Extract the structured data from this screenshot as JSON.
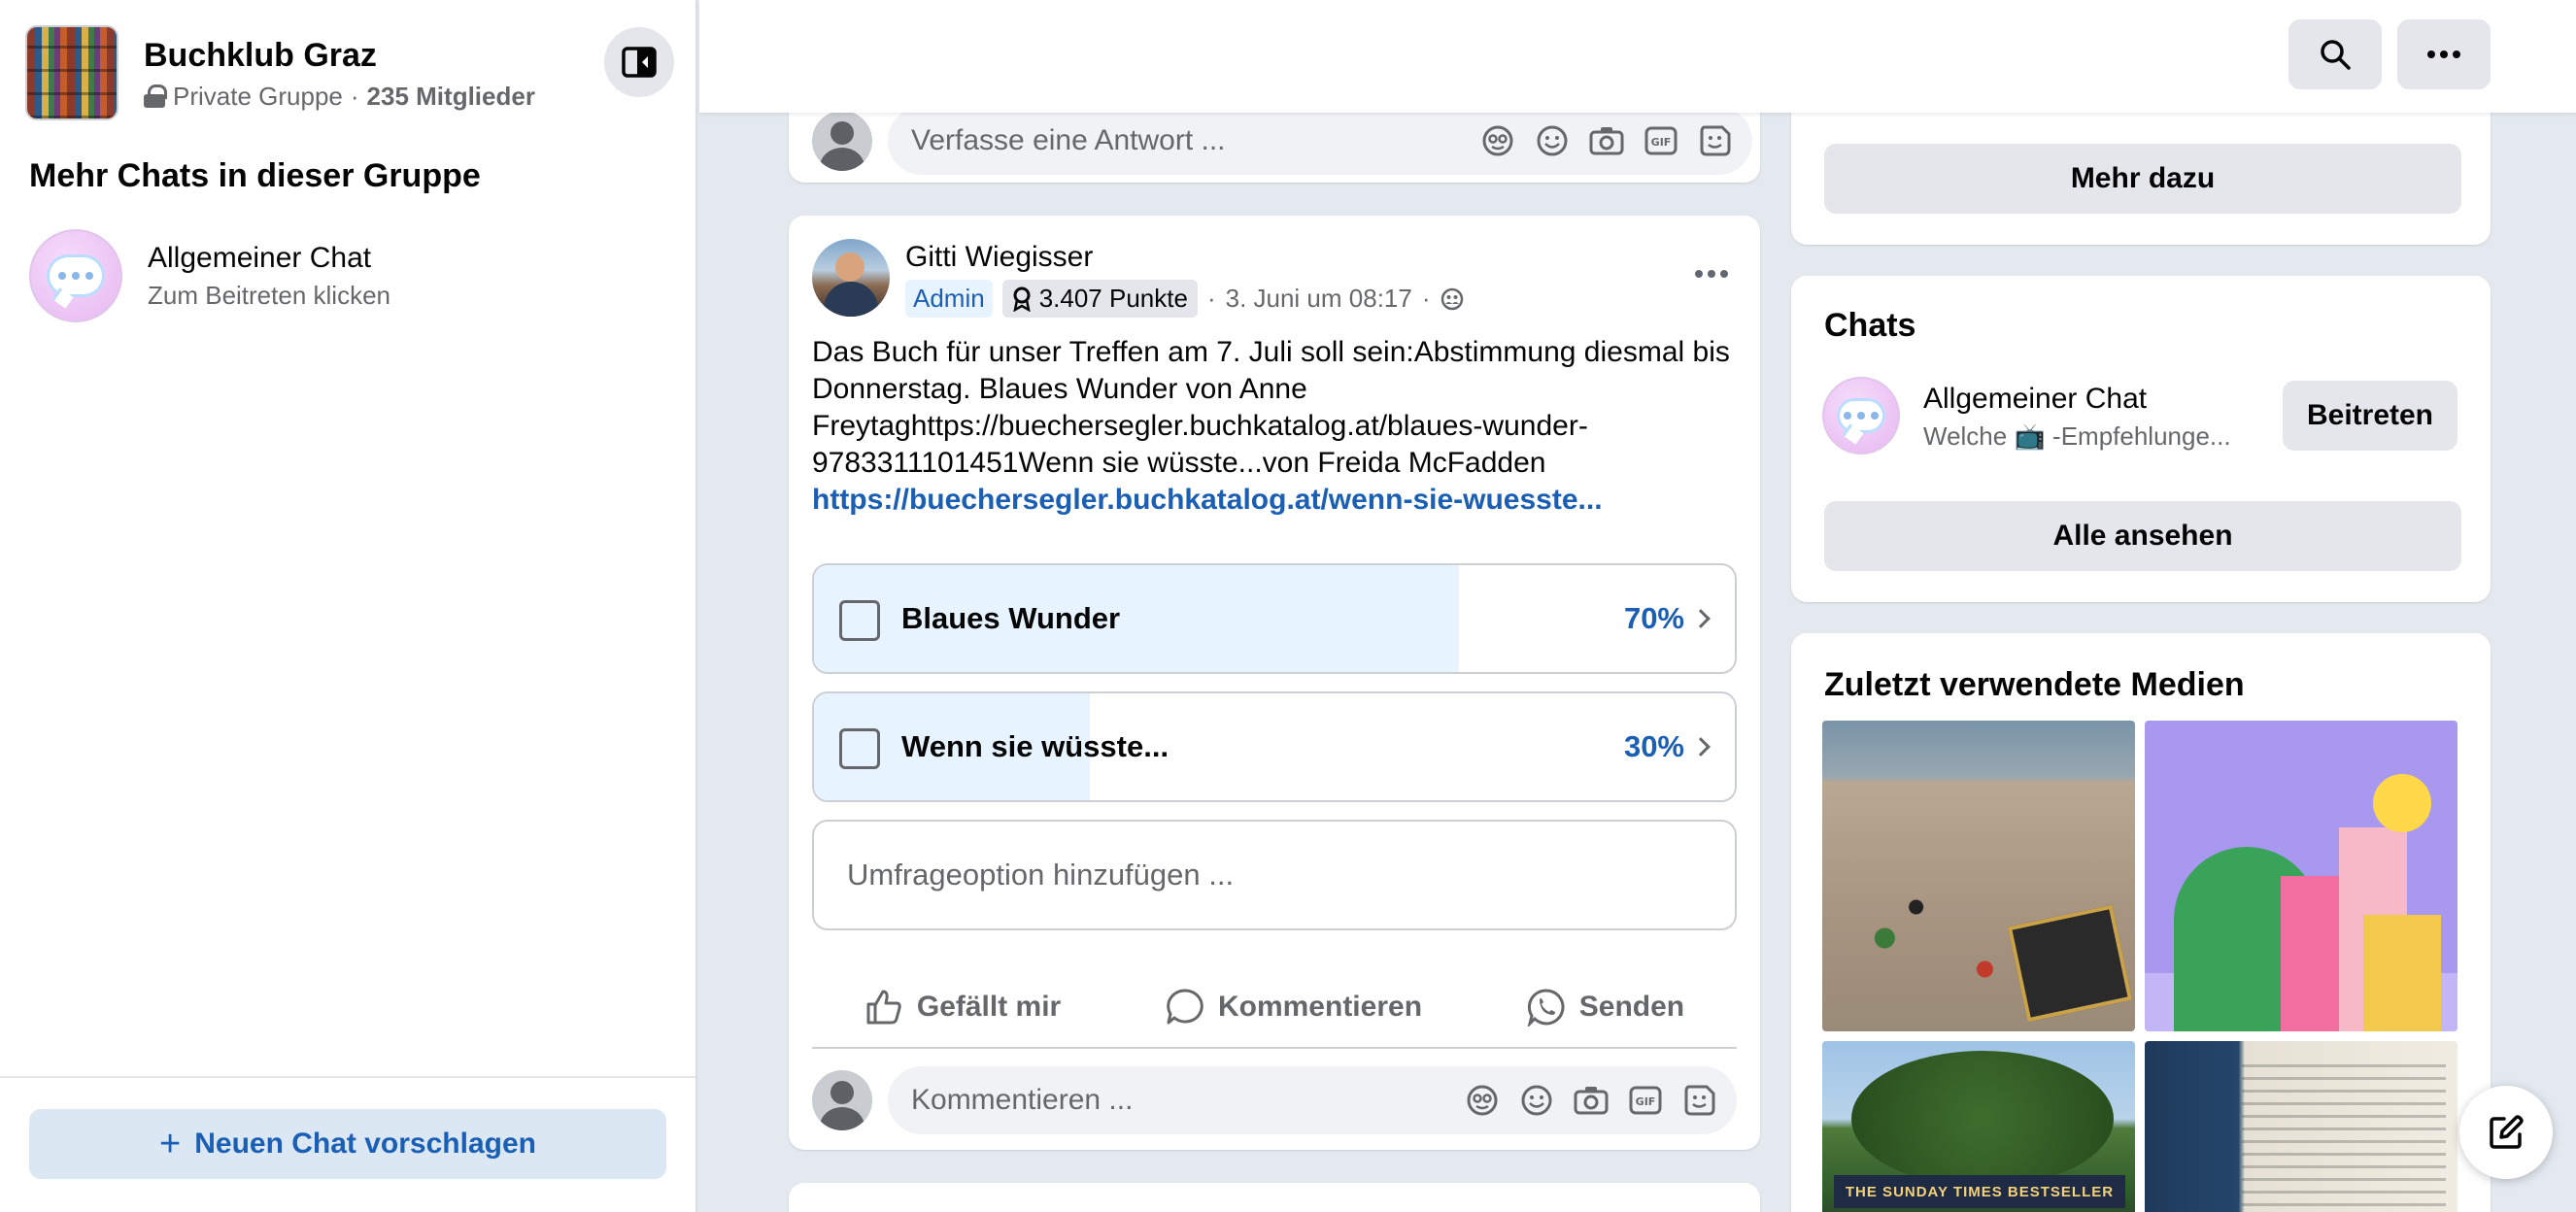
{
  "group": {
    "title": "Buchklub Graz",
    "privacy": "Private Gruppe",
    "separator": "·",
    "members": "235 Mitglieder"
  },
  "sidebar": {
    "section_title": "Mehr Chats in dieser Gruppe",
    "chats": [
      {
        "name": "Allgemeiner Chat",
        "subtitle": "Zum Beitreten klicken"
      }
    ],
    "suggest_button": "Neuen Chat vorschlagen"
  },
  "feed": {
    "reply_placeholder": "Verfasse eine Antwort ...",
    "post": {
      "author": "Gitti Wiegisser",
      "role": "Admin",
      "points": "3.407 Punkte",
      "timestamp": "3. Juni um 08:17",
      "separator": "·",
      "text": "Das Buch für unser Treffen am 7. Juli soll sein:Abstimmung diesmal bis Donnerstag. Blaues Wunder von Anne Freytaghttps://buechersegler.buchkatalog.at/blaues-wunder-9783311101451Wenn sie wüsste...von Freida McFadden",
      "link": "https://buechersegler.buchkatalog.at/wenn-sie-wuesste...",
      "poll": {
        "options": [
          {
            "label": "Blaues Wunder",
            "percent_label": "70%",
            "percent": 70
          },
          {
            "label": "Wenn sie wüsste...",
            "percent_label": "30%",
            "percent": 30
          }
        ],
        "add_placeholder": "Umfrageoption hinzufügen ..."
      },
      "actions": {
        "like": "Gefällt mir",
        "comment": "Kommentieren",
        "send": "Senden"
      },
      "comment_placeholder": "Kommentieren ..."
    }
  },
  "right": {
    "more_button": "Mehr dazu",
    "chats_title": "Chats",
    "chat": {
      "name": "Allgemeiner Chat",
      "preview": "Welche 📺 -Empfehlunge...",
      "join_button": "Beitreten"
    },
    "see_all_button": "Alle ansehen",
    "media_title": "Zuletzt verwendete Medien",
    "media_banner": "THE SUNDAY TIMES BESTSELLER"
  },
  "colors": {
    "accent": "#1b5fb4",
    "poll_fill": "#e7f3ff",
    "button_gray": "#e4e6eb",
    "background": "#e4e9f0"
  }
}
